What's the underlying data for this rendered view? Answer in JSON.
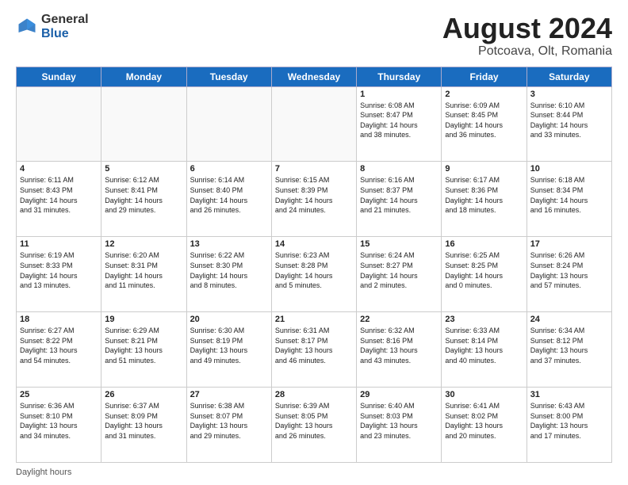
{
  "header": {
    "logo_general": "General",
    "logo_blue": "Blue",
    "title": "August 2024",
    "location": "Potcoava, Olt, Romania"
  },
  "days_of_week": [
    "Sunday",
    "Monday",
    "Tuesday",
    "Wednesday",
    "Thursday",
    "Friday",
    "Saturday"
  ],
  "footer": {
    "daylight_label": "Daylight hours"
  },
  "weeks": [
    [
      {
        "day": "",
        "info": ""
      },
      {
        "day": "",
        "info": ""
      },
      {
        "day": "",
        "info": ""
      },
      {
        "day": "",
        "info": ""
      },
      {
        "day": "1",
        "info": "Sunrise: 6:08 AM\nSunset: 8:47 PM\nDaylight: 14 hours\nand 38 minutes."
      },
      {
        "day": "2",
        "info": "Sunrise: 6:09 AM\nSunset: 8:45 PM\nDaylight: 14 hours\nand 36 minutes."
      },
      {
        "day": "3",
        "info": "Sunrise: 6:10 AM\nSunset: 8:44 PM\nDaylight: 14 hours\nand 33 minutes."
      }
    ],
    [
      {
        "day": "4",
        "info": "Sunrise: 6:11 AM\nSunset: 8:43 PM\nDaylight: 14 hours\nand 31 minutes."
      },
      {
        "day": "5",
        "info": "Sunrise: 6:12 AM\nSunset: 8:41 PM\nDaylight: 14 hours\nand 29 minutes."
      },
      {
        "day": "6",
        "info": "Sunrise: 6:14 AM\nSunset: 8:40 PM\nDaylight: 14 hours\nand 26 minutes."
      },
      {
        "day": "7",
        "info": "Sunrise: 6:15 AM\nSunset: 8:39 PM\nDaylight: 14 hours\nand 24 minutes."
      },
      {
        "day": "8",
        "info": "Sunrise: 6:16 AM\nSunset: 8:37 PM\nDaylight: 14 hours\nand 21 minutes."
      },
      {
        "day": "9",
        "info": "Sunrise: 6:17 AM\nSunset: 8:36 PM\nDaylight: 14 hours\nand 18 minutes."
      },
      {
        "day": "10",
        "info": "Sunrise: 6:18 AM\nSunset: 8:34 PM\nDaylight: 14 hours\nand 16 minutes."
      }
    ],
    [
      {
        "day": "11",
        "info": "Sunrise: 6:19 AM\nSunset: 8:33 PM\nDaylight: 14 hours\nand 13 minutes."
      },
      {
        "day": "12",
        "info": "Sunrise: 6:20 AM\nSunset: 8:31 PM\nDaylight: 14 hours\nand 11 minutes."
      },
      {
        "day": "13",
        "info": "Sunrise: 6:22 AM\nSunset: 8:30 PM\nDaylight: 14 hours\nand 8 minutes."
      },
      {
        "day": "14",
        "info": "Sunrise: 6:23 AM\nSunset: 8:28 PM\nDaylight: 14 hours\nand 5 minutes."
      },
      {
        "day": "15",
        "info": "Sunrise: 6:24 AM\nSunset: 8:27 PM\nDaylight: 14 hours\nand 2 minutes."
      },
      {
        "day": "16",
        "info": "Sunrise: 6:25 AM\nSunset: 8:25 PM\nDaylight: 14 hours\nand 0 minutes."
      },
      {
        "day": "17",
        "info": "Sunrise: 6:26 AM\nSunset: 8:24 PM\nDaylight: 13 hours\nand 57 minutes."
      }
    ],
    [
      {
        "day": "18",
        "info": "Sunrise: 6:27 AM\nSunset: 8:22 PM\nDaylight: 13 hours\nand 54 minutes."
      },
      {
        "day": "19",
        "info": "Sunrise: 6:29 AM\nSunset: 8:21 PM\nDaylight: 13 hours\nand 51 minutes."
      },
      {
        "day": "20",
        "info": "Sunrise: 6:30 AM\nSunset: 8:19 PM\nDaylight: 13 hours\nand 49 minutes."
      },
      {
        "day": "21",
        "info": "Sunrise: 6:31 AM\nSunset: 8:17 PM\nDaylight: 13 hours\nand 46 minutes."
      },
      {
        "day": "22",
        "info": "Sunrise: 6:32 AM\nSunset: 8:16 PM\nDaylight: 13 hours\nand 43 minutes."
      },
      {
        "day": "23",
        "info": "Sunrise: 6:33 AM\nSunset: 8:14 PM\nDaylight: 13 hours\nand 40 minutes."
      },
      {
        "day": "24",
        "info": "Sunrise: 6:34 AM\nSunset: 8:12 PM\nDaylight: 13 hours\nand 37 minutes."
      }
    ],
    [
      {
        "day": "25",
        "info": "Sunrise: 6:36 AM\nSunset: 8:10 PM\nDaylight: 13 hours\nand 34 minutes."
      },
      {
        "day": "26",
        "info": "Sunrise: 6:37 AM\nSunset: 8:09 PM\nDaylight: 13 hours\nand 31 minutes."
      },
      {
        "day": "27",
        "info": "Sunrise: 6:38 AM\nSunset: 8:07 PM\nDaylight: 13 hours\nand 29 minutes."
      },
      {
        "day": "28",
        "info": "Sunrise: 6:39 AM\nSunset: 8:05 PM\nDaylight: 13 hours\nand 26 minutes."
      },
      {
        "day": "29",
        "info": "Sunrise: 6:40 AM\nSunset: 8:03 PM\nDaylight: 13 hours\nand 23 minutes."
      },
      {
        "day": "30",
        "info": "Sunrise: 6:41 AM\nSunset: 8:02 PM\nDaylight: 13 hours\nand 20 minutes."
      },
      {
        "day": "31",
        "info": "Sunrise: 6:43 AM\nSunset: 8:00 PM\nDaylight: 13 hours\nand 17 minutes."
      }
    ]
  ]
}
